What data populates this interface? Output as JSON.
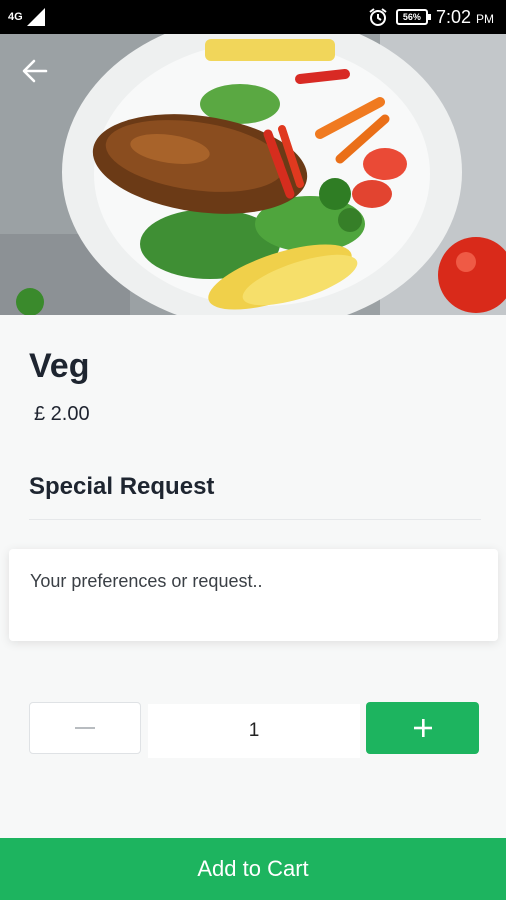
{
  "status_bar": {
    "network": "4G",
    "battery": "56%",
    "time": "7:02",
    "ampm": "PM",
    "icons": [
      "signal-icon",
      "alarm-icon",
      "battery-icon"
    ]
  },
  "hero": {
    "image": "food-plate-image",
    "back_icon": "arrow-left-icon"
  },
  "item": {
    "name": "Veg",
    "price": "£ 2.00"
  },
  "special_request": {
    "title": "Special Request",
    "placeholder": "Your preferences or request.."
  },
  "quantity": {
    "value": "1",
    "minus_icon": "minus-icon",
    "plus_icon": "plus-icon"
  },
  "cart_button": {
    "label": "Add to Cart"
  },
  "colors": {
    "accent": "#1db45f",
    "text_dark": "#1e2530",
    "background": "#f7f8f8"
  }
}
